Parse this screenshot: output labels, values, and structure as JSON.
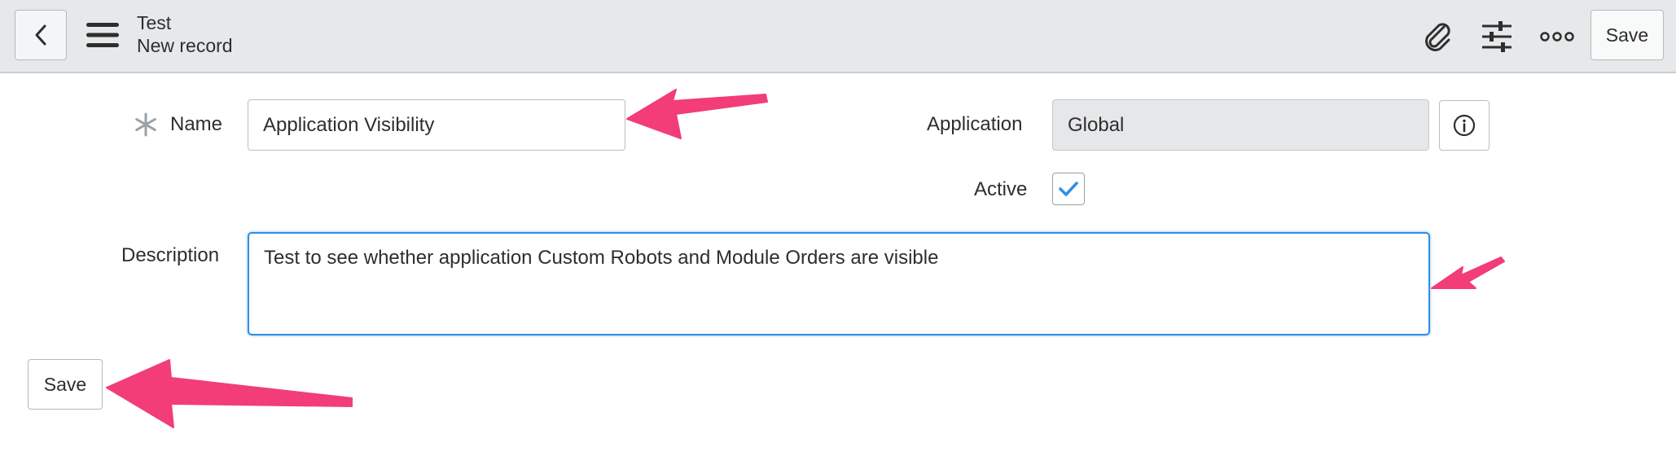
{
  "header": {
    "title": "Test",
    "subtitle": "New record",
    "save_label": "Save",
    "icons": [
      "back-chevron-icon",
      "menu-icon",
      "paperclip-icon",
      "sliders-icon",
      "more-icon"
    ]
  },
  "form": {
    "name_label": "Name",
    "name_value": "Application Visibility",
    "application_label": "Application",
    "application_value": "Global",
    "active_label": "Active",
    "active_checked": true,
    "description_label": "Description",
    "description_value": "Test to see whether application Custom Robots and Module Orders are visible",
    "save_label": "Save"
  },
  "colors": {
    "header_bg": "#e6e8ea",
    "accent_blue": "#2f8ee5",
    "arrow_pink": "#f23d78",
    "readonly_bg": "#e6e7e8"
  }
}
